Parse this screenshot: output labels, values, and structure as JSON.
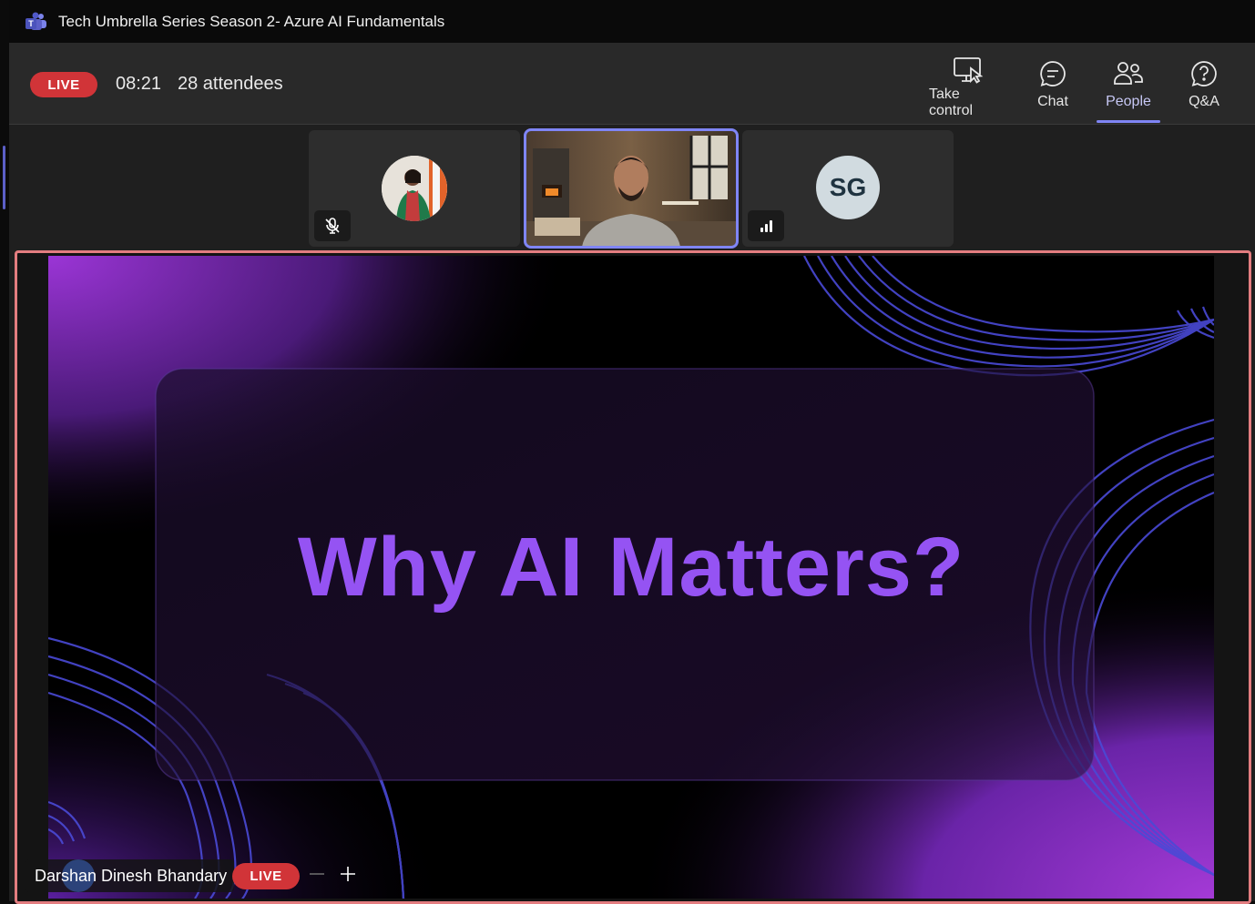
{
  "window": {
    "title": "Tech Umbrella Series Season 2- Azure AI Fundamentals",
    "app_icon": "teams-icon"
  },
  "header": {
    "live_label": "LIVE",
    "elapsed": "08:21",
    "attendees": "28 attendees",
    "buttons": [
      {
        "label": "Take control",
        "icon": "take-control-icon",
        "active": false
      },
      {
        "label": "Chat",
        "icon": "chat-icon",
        "active": false
      },
      {
        "label": "People",
        "icon": "people-icon",
        "active": true
      },
      {
        "label": "Q&A",
        "icon": "qna-icon",
        "active": false
      }
    ]
  },
  "participants": [
    {
      "kind": "photo",
      "muted": true,
      "icon": "mic-off-icon"
    },
    {
      "kind": "video",
      "speaking": true
    },
    {
      "kind": "initials",
      "initials": "SG",
      "icon": "signal-icon"
    }
  ],
  "share": {
    "slide_title": "Why AI Matters?",
    "presenter_name": "Darshan Dinesh Bhandary",
    "live_label": "LIVE",
    "zoom_out_icon": "minus-icon",
    "zoom_in_icon": "plus-icon"
  },
  "colors": {
    "accent": "#7f85f5",
    "live": "#d13438",
    "share_border": "#e37d80",
    "slide_text": "#9553f3"
  }
}
